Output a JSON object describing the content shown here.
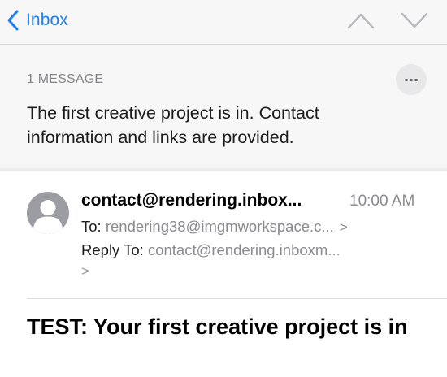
{
  "navbar": {
    "back_label": "Inbox",
    "accent_color": "#1e7cf2",
    "icons": [
      "chevron-left-icon",
      "chevron-up-icon",
      "chevron-down-icon"
    ]
  },
  "thread": {
    "message_count": "1 MESSAGE",
    "summary": "The first creative project is in. Contact information and links are provided.",
    "more_icon": "ellipsis-icon"
  },
  "message": {
    "sender": "contact@rendering.inbox...",
    "time": "10:00 AM",
    "to_label": "To:",
    "to_value": "rendering38@imgmworkspace.c...",
    "reply_to_label": "Reply To:",
    "reply_to_value": "contact@rendering.inboxm...",
    "chevron": ">",
    "subject": "TEST: Your first creative project is in",
    "avatar_icon": "person-avatar-icon"
  }
}
